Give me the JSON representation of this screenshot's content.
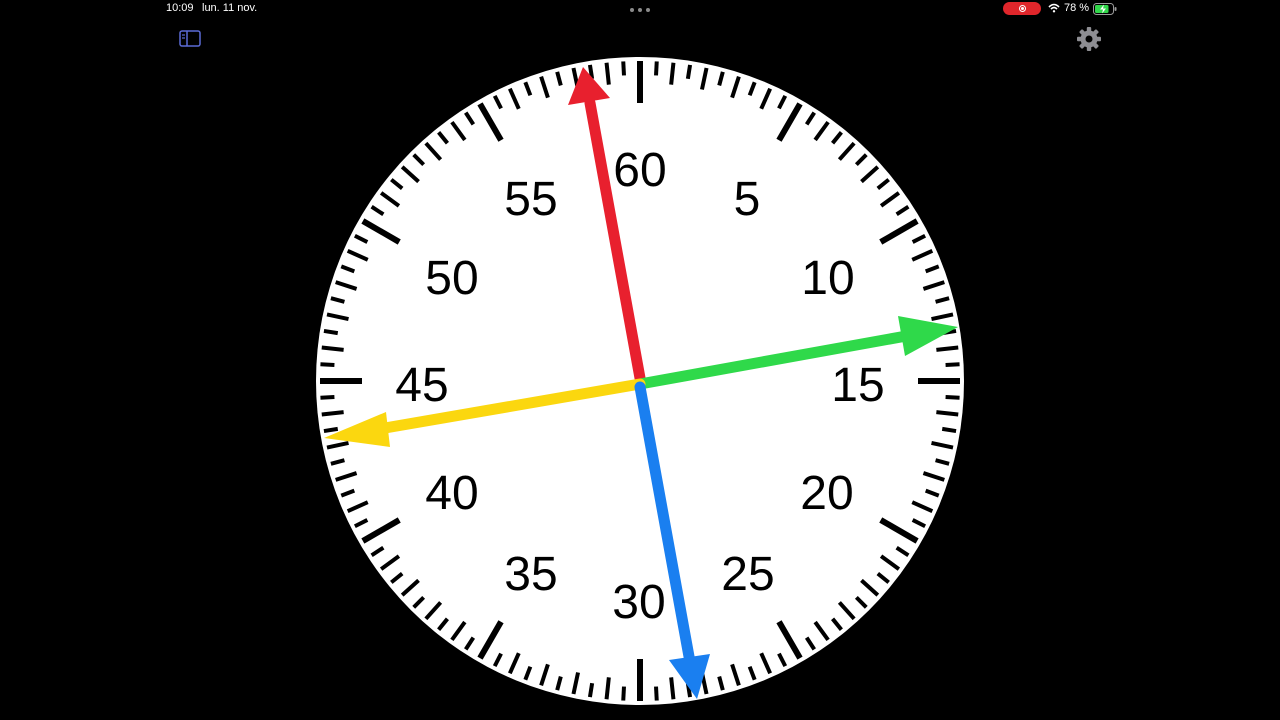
{
  "status_bar": {
    "time": "10:09",
    "date": "lun. 11 nov.",
    "battery_percent": "78 %",
    "battery_level": 0.78,
    "recording_color": "#e0262b"
  },
  "toolbar": {
    "sidebar_icon": "sidebar-toggle-icon",
    "settings_icon": "gear-icon",
    "accent_color": "#5b6bd6"
  },
  "clock_face": {
    "numbers": [
      "60",
      "5",
      "10",
      "15",
      "20",
      "25",
      "30",
      "35",
      "40",
      "45",
      "50",
      "55"
    ],
    "hands": [
      {
        "color": "#e8202e",
        "name": "red"
      },
      {
        "color": "#2fd94a",
        "name": "green"
      },
      {
        "color": "#1a7ff0",
        "name": "blue"
      },
      {
        "color": "#fbd70f",
        "name": "yellow"
      }
    ]
  }
}
